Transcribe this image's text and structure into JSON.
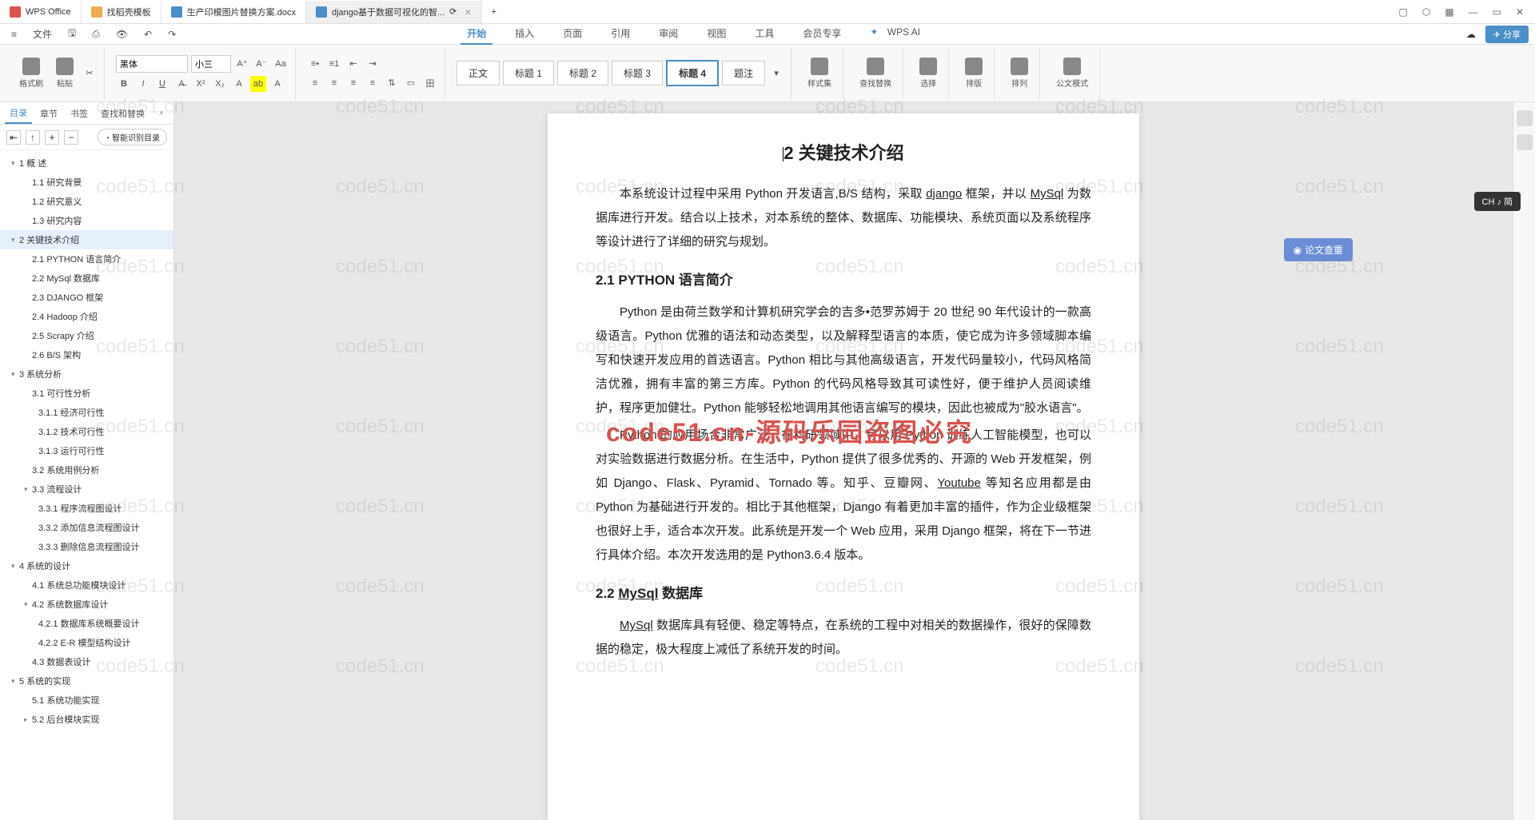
{
  "tabs": [
    {
      "label": "WPS Office"
    },
    {
      "label": "找稻壳模板"
    },
    {
      "label": "生产印模图片替换方案.docx"
    },
    {
      "label": "django基于数据可视化的智..."
    }
  ],
  "menu": {
    "file": "文件",
    "ribbon": [
      "开始",
      "插入",
      "页面",
      "引用",
      "审阅",
      "视图",
      "工具",
      "会员专享"
    ],
    "ai": "WPS AI",
    "share": "分享"
  },
  "toolbar": {
    "format_painter": "格式刷",
    "paste": "粘贴",
    "font_name": "黑体",
    "font_size": "小三",
    "styles": {
      "body": "正文",
      "h1": "标题 1",
      "h2": "标题 2",
      "h3": "标题 3",
      "h4": "标题 4",
      "caption": "题注"
    },
    "style_lbl": "样式集",
    "find_lbl": "查找替换",
    "select_lbl": "选择",
    "layout_lbl": "排版",
    "arrange_lbl": "排列",
    "doc_mode": "公文模式"
  },
  "nav": {
    "tabs": [
      "目录",
      "章节",
      "书签",
      "查找和替换"
    ],
    "smart": "智能识别目录",
    "items": [
      {
        "lvl": 1,
        "num": "1",
        "text": "概    述",
        "arr": "▾"
      },
      {
        "lvl": 2,
        "text": "1.1 研究背景"
      },
      {
        "lvl": 2,
        "text": "1.2 研究意义"
      },
      {
        "lvl": 2,
        "text": "1.3 研究内容"
      },
      {
        "lvl": 1,
        "num": "2",
        "text": "关键技术介绍",
        "arr": "▾",
        "active": true
      },
      {
        "lvl": 2,
        "text": "2.1 PYTHON 语言简介"
      },
      {
        "lvl": 2,
        "text": "2.2 MySql 数据库"
      },
      {
        "lvl": 2,
        "text": "2.3 DJANGO 框架"
      },
      {
        "lvl": 2,
        "text": "2.4 Hadoop 介绍"
      },
      {
        "lvl": 2,
        "text": "2.5 Scrapy 介绍"
      },
      {
        "lvl": 2,
        "text": "2.6 B/S 架构"
      },
      {
        "lvl": 1,
        "num": "3",
        "text": "系统分析",
        "arr": "▾"
      },
      {
        "lvl": 2,
        "text": "3.1 可行性分析"
      },
      {
        "lvl": 3,
        "text": "3.1.1 经济可行性"
      },
      {
        "lvl": 3,
        "text": "3.1.2 技术可行性"
      },
      {
        "lvl": 3,
        "text": "3.1.3 运行可行性"
      },
      {
        "lvl": 2,
        "text": "3.2 系统用例分析"
      },
      {
        "lvl": 2,
        "text": "3.3 流程设计",
        "arr": "▾"
      },
      {
        "lvl": 3,
        "text": "3.3.1 程序流程图设计"
      },
      {
        "lvl": 3,
        "text": "3.3.2 添加信息流程图设计"
      },
      {
        "lvl": 3,
        "text": "3.3.3 删除信息流程图设计"
      },
      {
        "lvl": 1,
        "num": "4",
        "text": "系统的设计",
        "arr": "▾"
      },
      {
        "lvl": 2,
        "text": "4.1 系统总功能模块设计"
      },
      {
        "lvl": 2,
        "text": "4.2 系统数据库设计",
        "arr": "▾"
      },
      {
        "lvl": 3,
        "text": "4.2.1 数据库系统概要设计"
      },
      {
        "lvl": 3,
        "text": "4.2.2 E-R 模型结构设计"
      },
      {
        "lvl": 2,
        "text": "4.3 数据表设计"
      },
      {
        "lvl": 1,
        "num": "5",
        "text": "系统的实现",
        "arr": "▾"
      },
      {
        "lvl": 2,
        "text": "5.1 系统功能实现"
      },
      {
        "lvl": 2,
        "text": "5.2 后台模块实现",
        "arr": "▸"
      }
    ]
  },
  "doc": {
    "title": "2  关键技术介绍",
    "intro": "本系统设计过程中采用 Python 开发语言,B/S 结构，采取 django 框架，并以 MySql 为数据库进行开发。结合以上技术，对本系统的整体、数据库、功能模块、系统页面以及系统程序等设计进行了详细的研究与规划。",
    "h21": "2.1 PYTHON 语言简介",
    "p21a": "Python 是由荷兰数学和计算机研究学会的吉多•范罗苏姆于 20 世纪 90 年代设计的一款高级语言。Python 优雅的语法和动态类型，以及解释型语言的本质，使它成为许多领域脚本编写和快速开发应用的首选语言。Python 相比与其他高级语言，开发代码量较小，代码风格简洁优雅，拥有丰富的第三方库。Python 的代码风格导致其可读性好，便于维护人员阅读维护，程序更加健壮。Python 能够轻松地调用其他语言编写的模块，因此也被成为\"胶水语言\"。",
    "p21b": "Python 的应用场合非常广泛，在科研领域中，可以用 Python 训练人工智能模型，也可以对实验数据进行数据分析。在生活中，Python 提供了很多优秀的、开源的 Web 开发框架，例如 Django、Flask、Pyramid、Tornado 等。知乎、豆瓣网、Youtube 等知名应用都是由 Python 为基础进行开发的。相比于其他框架，Django 有着更加丰富的插件，作为企业级框架也很好上手，适合本次开发。此系统是开发一个 Web 应用，采用 Django 框架，将在下一节进行具体介绍。本次开发选用的是 Python3.6.4 版本。",
    "h22": "2.2 MySql 数据库",
    "p22": "MySql 数据库具有轻便、稳定等特点，在系统的工程中对相关的数据操作，很好的保障数据的稳定，极大程度上减低了系统开发的时间。"
  },
  "float": {
    "check": "论文查重"
  },
  "ime": "CH ♪ 简",
  "watermark_text": "code51.cn",
  "red_banner": "code51.cn-源码乐园盗图必究"
}
